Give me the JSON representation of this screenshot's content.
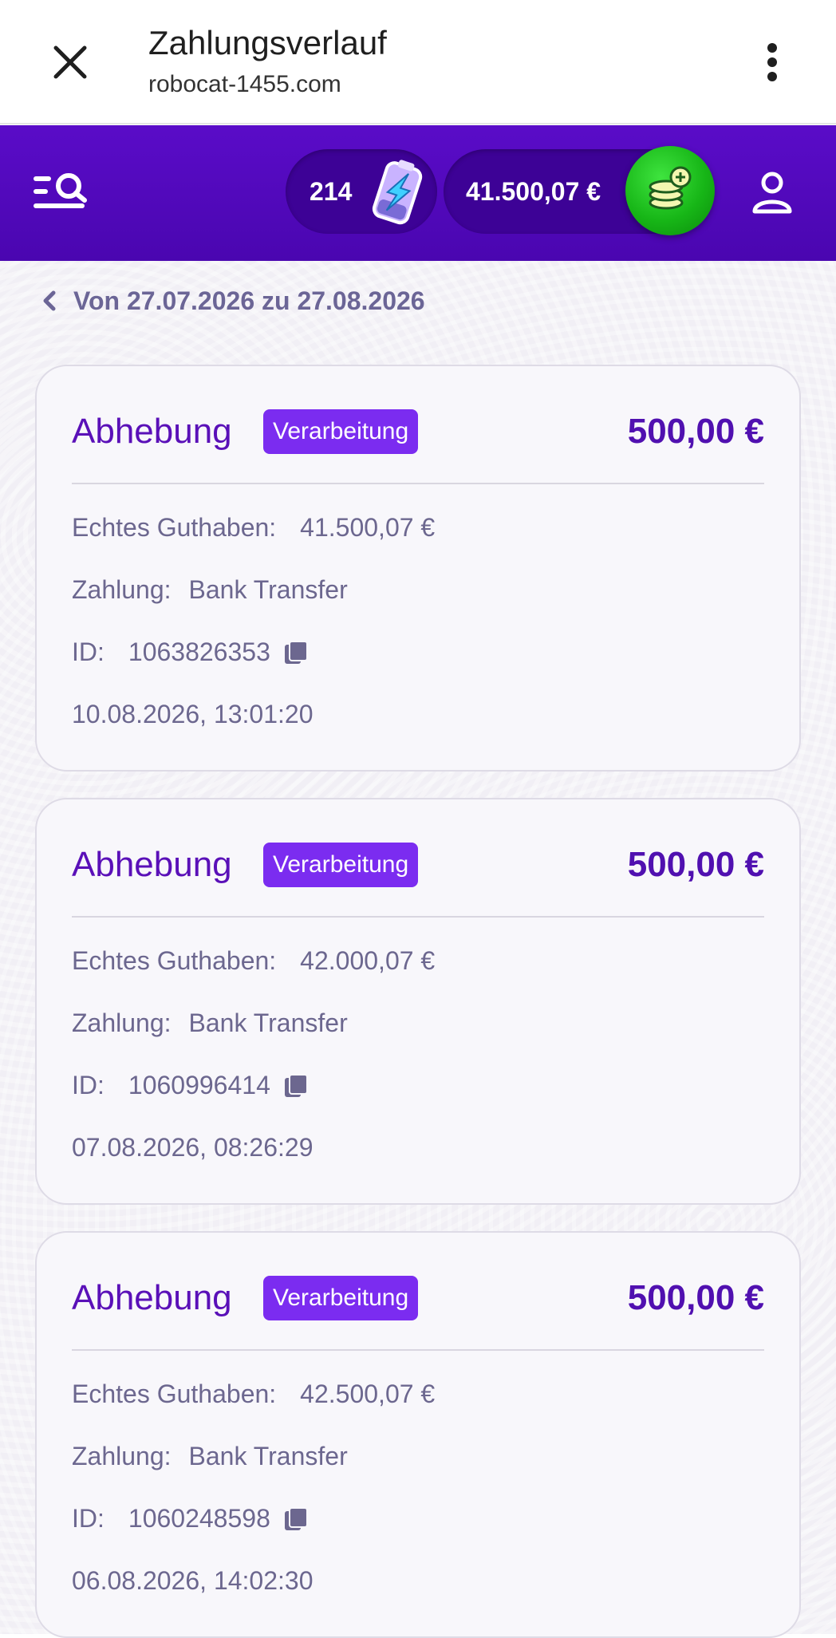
{
  "browser": {
    "title": "Zahlungsverlauf",
    "url": "robocat-1455.com"
  },
  "header": {
    "energy_count": "214",
    "balance": "41.500,07 €"
  },
  "range": {
    "label": "Von 27.07.2026 zu 27.08.2026"
  },
  "transactions": [
    {
      "type": "Abhebung",
      "status": "Verarbeitung",
      "amount": "500,00 €",
      "balance_label": "Echtes Guthaben:",
      "balance_value": "41.500,07 €",
      "payment_label": "Zahlung:",
      "payment_value": "Bank Transfer",
      "id_label": "ID:",
      "id_value": "1063826353",
      "datetime": "10.08.2026, 13:01:20"
    },
    {
      "type": "Abhebung",
      "status": "Verarbeitung",
      "amount": "500,00 €",
      "balance_label": "Echtes Guthaben:",
      "balance_value": "42.000,07 €",
      "payment_label": "Zahlung:",
      "payment_value": "Bank Transfer",
      "id_label": "ID:",
      "id_value": "1060996414",
      "datetime": "07.08.2026, 08:26:29"
    },
    {
      "type": "Abhebung",
      "status": "Verarbeitung",
      "amount": "500,00 €",
      "balance_label": "Echtes Guthaben:",
      "balance_value": "42.500,07 €",
      "payment_label": "Zahlung:",
      "payment_value": "Bank Transfer",
      "id_label": "ID:",
      "id_value": "1060248598",
      "datetime": "06.08.2026, 14:02:30"
    }
  ],
  "colors": {
    "header_purple": "#5a0cc8",
    "status_badge": "#7b2cf0",
    "amount_text": "#5010b0",
    "deposit_green": "#17b617"
  },
  "icons": {
    "close": "close-icon",
    "menu": "kebab-menu-icon",
    "menu_search": "menu-search-icon",
    "energy": "battery-bolt-icon",
    "deposit": "coin-stack-plus-icon",
    "profile": "user-icon",
    "back": "chevron-left-icon",
    "copy": "copy-icon"
  }
}
